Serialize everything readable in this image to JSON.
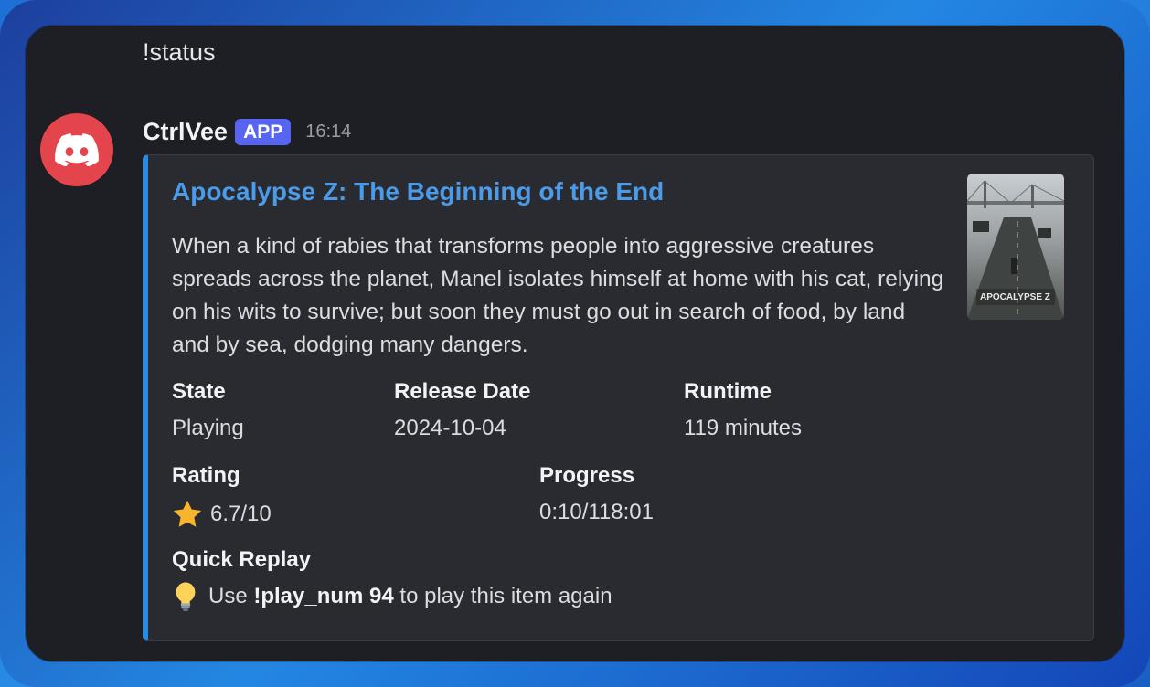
{
  "command_message": "!status",
  "bot": {
    "username": "CtrlVee",
    "badge": "APP",
    "timestamp": "16:14",
    "avatar_icon": "discord-logo-icon"
  },
  "embed": {
    "accent_color": "#2b8be0",
    "title": "Apocalypse Z: The Beginning of the End",
    "description": "When a kind of rabies that transforms people into aggressive creatures spreads across the planet, Manel isolates himself at home with his cat, relying on his wits to survive; but soon they must go out in search of food, by land and by sea, dodging many dangers.",
    "thumbnail_text": "APOCALYPSE Z",
    "fields": {
      "state": {
        "name": "State",
        "value": "Playing"
      },
      "release_date": {
        "name": "Release Date",
        "value": "2024-10-04"
      },
      "runtime": {
        "name": "Runtime",
        "value": "119 minutes"
      },
      "rating": {
        "name": "Rating",
        "value": "6.7/10",
        "icon": "star-icon"
      },
      "progress": {
        "name": "Progress",
        "value": "0:10/118:01"
      },
      "quick_replay": {
        "name": "Quick Replay",
        "icon": "lightbulb-icon",
        "prefix": "Use",
        "command": "!play_num 94",
        "suffix": "to play this item again"
      }
    }
  }
}
